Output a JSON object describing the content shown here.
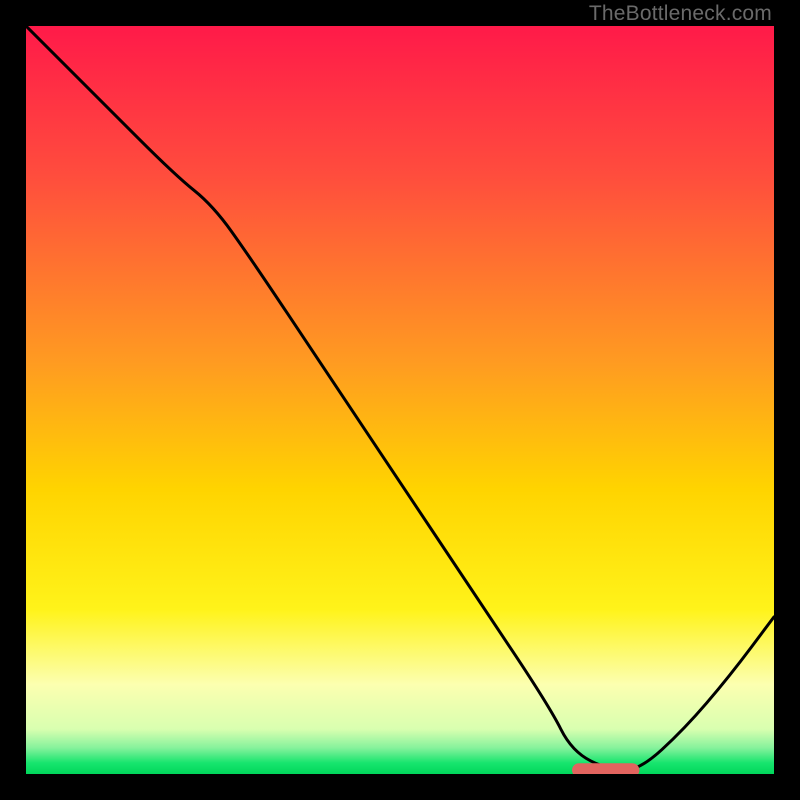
{
  "watermark": "TheBottleneck.com",
  "chart_data": {
    "type": "line",
    "title": "",
    "xlabel": "",
    "ylabel": "",
    "xlim": [
      0,
      100
    ],
    "ylim": [
      0,
      100
    ],
    "grid": false,
    "legend": false,
    "gradient_stops": [
      {
        "t": 0.0,
        "color": "#ff1a49"
      },
      {
        "t": 0.2,
        "color": "#ff4d3d"
      },
      {
        "t": 0.45,
        "color": "#ff9b21"
      },
      {
        "t": 0.62,
        "color": "#ffd400"
      },
      {
        "t": 0.78,
        "color": "#fff31a"
      },
      {
        "t": 0.88,
        "color": "#fcffb0"
      },
      {
        "t": 0.94,
        "color": "#d9ffb0"
      },
      {
        "t": 0.965,
        "color": "#86f29c"
      },
      {
        "t": 0.985,
        "color": "#18e56e"
      },
      {
        "t": 1.0,
        "color": "#00d75b"
      }
    ],
    "series": [
      {
        "name": "curve",
        "x": [
          0.0,
          10.0,
          20.0,
          25.0,
          30.0,
          40.0,
          50.0,
          60.0,
          70.0,
          73.0,
          78.0,
          82.0,
          88.0,
          94.0,
          100.0
        ],
        "y": [
          100.0,
          90.0,
          80.0,
          76.0,
          69.0,
          54.0,
          39.0,
          24.0,
          9.0,
          3.0,
          0.5,
          0.5,
          6.0,
          13.0,
          21.0
        ]
      }
    ],
    "marker": {
      "name": "optimum-marker",
      "x_start": 73.0,
      "x_end": 82.0,
      "y": 0.5,
      "color": "#e2645f"
    }
  }
}
